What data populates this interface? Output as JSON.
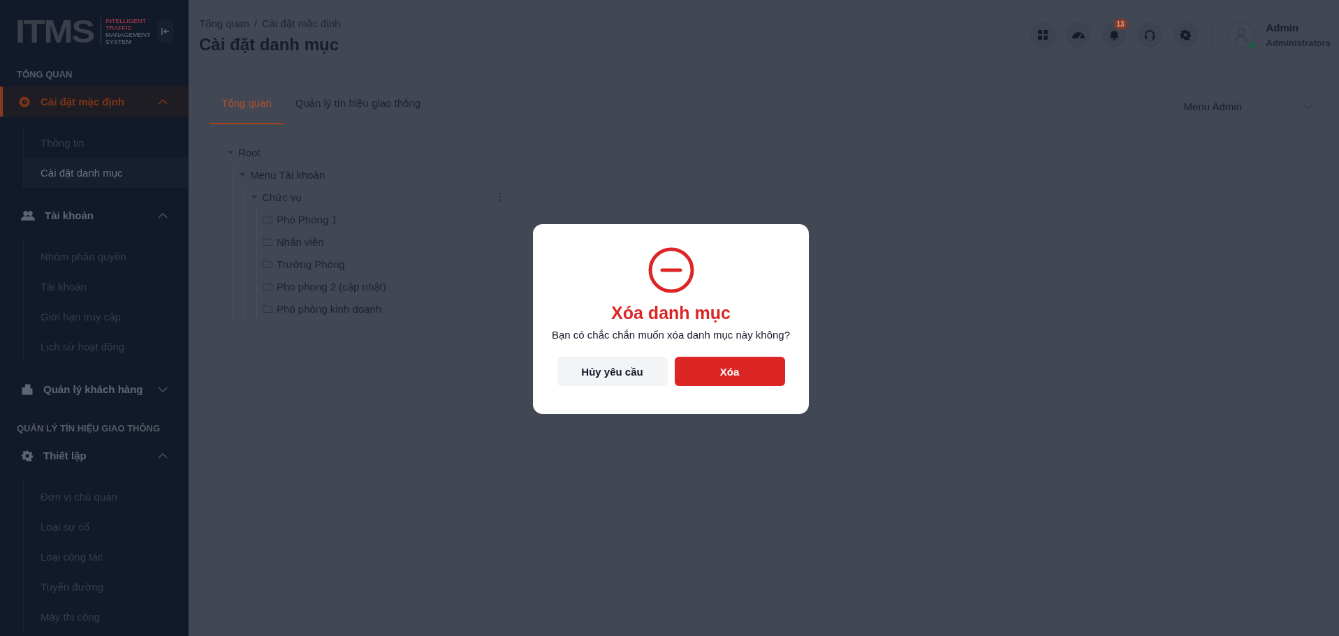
{
  "sidebar": {
    "logo": {
      "mark": "ITMS",
      "tagline": [
        "INTELLIGENT",
        "TRAFFIC",
        "MANAGEMENT",
        "SYSTEM"
      ]
    },
    "sections": [
      {
        "title": "TỔNG QUAN",
        "menus": [
          {
            "label": "Cài đặt mặc định",
            "active": true,
            "expanded": true,
            "items": [
              {
                "label": "Thông tin",
                "selected": false
              },
              {
                "label": "Cài đặt danh mục",
                "selected": true
              }
            ]
          },
          {
            "label": "Tài khoản",
            "active": false,
            "expanded": true,
            "items": [
              {
                "label": "Nhóm phân quyền",
                "selected": false
              },
              {
                "label": "Tài khoản",
                "selected": false
              },
              {
                "label": "Giới hạn truy cập",
                "selected": false
              },
              {
                "label": "Lịch sử hoạt động",
                "selected": false
              }
            ]
          },
          {
            "label": "Quản lý khách hàng",
            "active": false,
            "expanded": false
          }
        ]
      },
      {
        "title": "QUẢN LÝ TÍN HIỆU GIAO THÔNG",
        "menus": [
          {
            "label": "Thiết lập",
            "active": false,
            "expanded": true,
            "items": [
              {
                "label": "Đơn vị chủ quản",
                "selected": false
              },
              {
                "label": "Loại sự cố",
                "selected": false
              },
              {
                "label": "Loại công tác",
                "selected": false
              },
              {
                "label": "Tuyến đường",
                "selected": false
              },
              {
                "label": "Máy thi công",
                "selected": false
              }
            ]
          }
        ]
      }
    ]
  },
  "header": {
    "breadcrumb": [
      "Tổng quan",
      "Cài đặt mặc định"
    ],
    "separator": "/",
    "title": "Cài đặt danh mục",
    "notification_count": "13",
    "user": {
      "name": "Admin",
      "role": "Administrators",
      "online": true
    }
  },
  "tabs": [
    {
      "label": "Tổng quan",
      "selected": true
    },
    {
      "label": "Quản lý tín hiệu giao thông",
      "selected": false
    }
  ],
  "menu_select": {
    "value": "Menu Admin"
  },
  "tree": [
    {
      "label": "Root",
      "kind": "branch",
      "expanded": true,
      "show_actions": false,
      "children": [
        {
          "label": "Menu Tài khoản",
          "kind": "branch",
          "expanded": true,
          "show_actions": false,
          "children": [
            {
              "label": "Chức vụ",
              "kind": "branch",
              "expanded": true,
              "show_actions": true,
              "children": [
                {
                  "label": "Phó Phòng 1",
                  "kind": "folder",
                  "show_actions": false
                },
                {
                  "label": "Nhân viên",
                  "kind": "folder",
                  "show_actions": false
                },
                {
                  "label": "Trưởng Phòng",
                  "kind": "folder",
                  "show_actions": false
                },
                {
                  "label": "Pho phong 2 (cập nhật)",
                  "kind": "folder",
                  "show_actions": false
                },
                {
                  "label": "Phó phòng kinh doanh",
                  "kind": "folder",
                  "show_actions": false
                }
              ]
            }
          ]
        }
      ]
    }
  ],
  "dialog": {
    "title": "Xóa danh mục",
    "message": "Bạn có chắc chắn muốn xóa danh mục này không?",
    "cancel": "Hủy yêu cầu",
    "confirm": "Xóa"
  }
}
